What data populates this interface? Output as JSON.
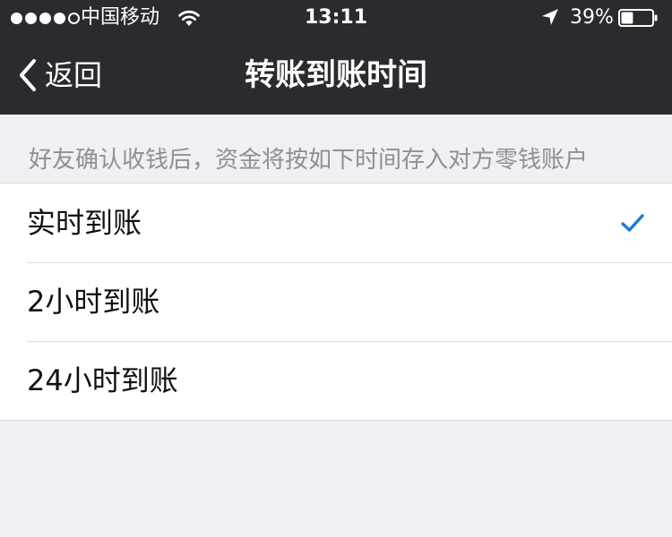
{
  "status_bar": {
    "carrier": "中国移动",
    "time": "13:11",
    "battery_percent": "39%",
    "battery_level": 0.39,
    "signal_strength": 4,
    "signal_max": 5,
    "icons": [
      "signal-dots-icon",
      "wifi-icon",
      "location-arrow-icon",
      "battery-icon"
    ]
  },
  "nav": {
    "back_label": "返回",
    "back_icon": "chevron-left-icon",
    "title": "转账到账时间"
  },
  "section": {
    "hint": "好友确认收钱后，资金将按如下时间存入对方零钱账户"
  },
  "options": [
    {
      "label": "实时到账",
      "selected": true
    },
    {
      "label": "2小时到账",
      "selected": false
    },
    {
      "label": "24小时到账",
      "selected": false
    }
  ],
  "colors": {
    "nav_background": "#2b2b2f",
    "page_background": "#efeff4",
    "check_accent": "#1a7ad8",
    "hint_text": "#8e8e93"
  }
}
